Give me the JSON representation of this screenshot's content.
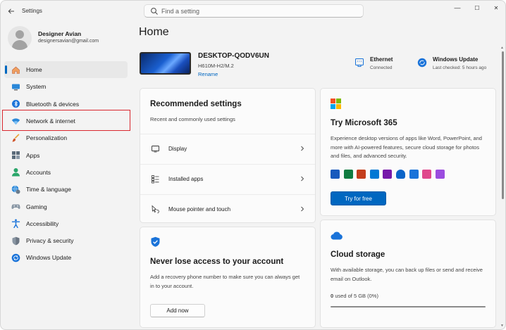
{
  "window": {
    "app_title": "Settings",
    "minimize": "—",
    "maximize": "☐",
    "close": "✕"
  },
  "search": {
    "placeholder": "Find a setting"
  },
  "profile": {
    "name": "Designer Avian",
    "email": "designersavian@gmail.com"
  },
  "sidebar": {
    "items": [
      {
        "label": "Home",
        "icon": "home-icon",
        "active": true
      },
      {
        "label": "System",
        "icon": "system-icon"
      },
      {
        "label": "Bluetooth & devices",
        "icon": "bluetooth-icon"
      },
      {
        "label": "Network & internet",
        "icon": "wifi-icon",
        "highlighted": true
      },
      {
        "label": "Personalization",
        "icon": "brush-icon"
      },
      {
        "label": "Apps",
        "icon": "apps-icon"
      },
      {
        "label": "Accounts",
        "icon": "accounts-icon"
      },
      {
        "label": "Time & language",
        "icon": "globe-clock-icon"
      },
      {
        "label": "Gaming",
        "icon": "gamepad-icon"
      },
      {
        "label": "Accessibility",
        "icon": "accessibility-icon"
      },
      {
        "label": "Privacy & security",
        "icon": "shield-icon"
      },
      {
        "label": "Windows Update",
        "icon": "windows-update-icon"
      }
    ]
  },
  "main": {
    "title": "Home",
    "device": {
      "name": "DESKTOP-QODV6UN",
      "model": "H610M-H2/M.2",
      "rename": "Rename"
    },
    "status": {
      "ethernet": {
        "title": "Ethernet",
        "sub": "Connected"
      },
      "update": {
        "title": "Windows Update",
        "sub": "Last checked: 5 hours ago"
      }
    },
    "recommended": {
      "title": "Recommended settings",
      "subtitle": "Recent and commonly used settings",
      "items": [
        {
          "label": "Display",
          "icon": "display-icon"
        },
        {
          "label": "Installed apps",
          "icon": "installed-apps-icon"
        },
        {
          "label": "Mouse pointer and touch",
          "icon": "mouse-pointer-icon"
        }
      ]
    },
    "account": {
      "title": "Never lose access to your account",
      "body": "Add a recovery phone number to make sure you can always get in to your account.",
      "button": "Add now"
    },
    "m365": {
      "title": "Try Microsoft 365",
      "body": "Experience desktop versions of apps like Word, PowerPoint, and more with AI-powered features, secure cloud storage for photos and files, and advanced security.",
      "button": "Try for free"
    },
    "cloud": {
      "title": "Cloud storage",
      "body": "With available storage, you can back up files or send and receive email on Outlook.",
      "used_value": "0",
      "used_rest": " used of 5 GB (0%)",
      "progress": 0
    }
  },
  "colors": {
    "accent": "#0067c0",
    "highlight": "#d9272e"
  }
}
